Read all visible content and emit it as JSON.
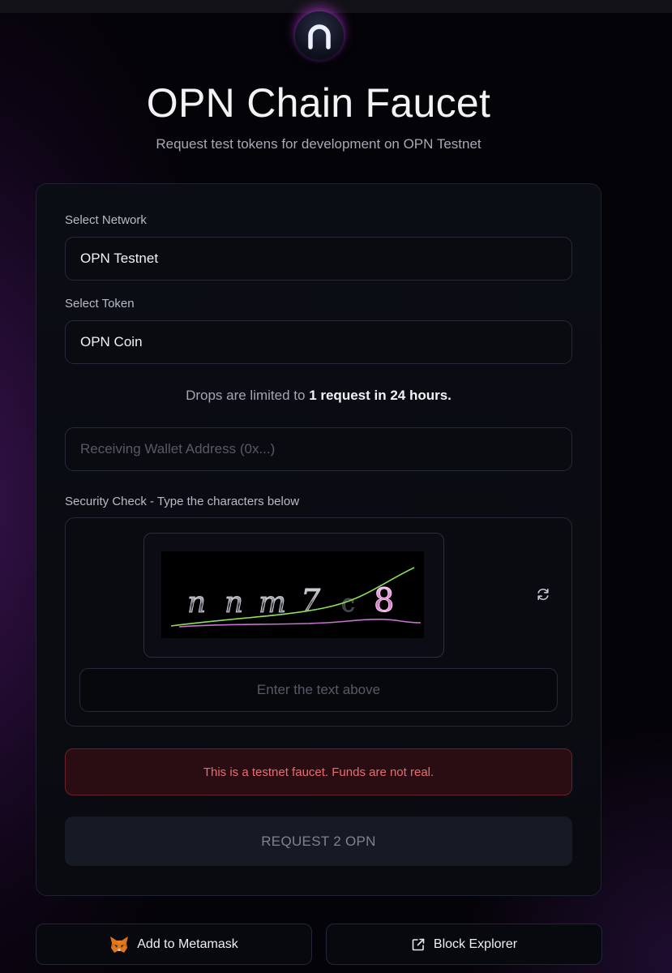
{
  "header": {
    "logo_icon": "opn-logo-icon",
    "title": "OPN Chain Faucet",
    "subtitle": "Request test tokens for development on OPN Testnet"
  },
  "form": {
    "network": {
      "label": "Select Network",
      "value": "OPN Testnet"
    },
    "token": {
      "label": "Select Token",
      "value": "OPN Coin"
    },
    "limit": {
      "prefix": "Drops are limited to ",
      "emphasis": "1 request in 24 hours."
    },
    "wallet": {
      "placeholder": "Receiving Wallet Address (0x...)"
    },
    "security": {
      "label": "Security Check - Type the characters below",
      "captcha_chars": [
        "n",
        "n",
        "m",
        "7",
        "c",
        "8"
      ],
      "refresh_icon": "refresh-icon",
      "input_placeholder": "Enter the text above"
    },
    "warning": "This is a testnet faucet. Funds are not real.",
    "submit_label": "REQUEST 2 OPN"
  },
  "footer": {
    "metamask": {
      "label": "Add to Metamask",
      "icon": "metamask-fox-icon"
    },
    "explorer": {
      "label": "Block Explorer",
      "icon": "external-link-icon"
    }
  },
  "colors": {
    "background": "#040307",
    "accent_purple": "#5f1e82",
    "warning_text": "#e76d73",
    "warning_bg": "#2a0d12"
  }
}
